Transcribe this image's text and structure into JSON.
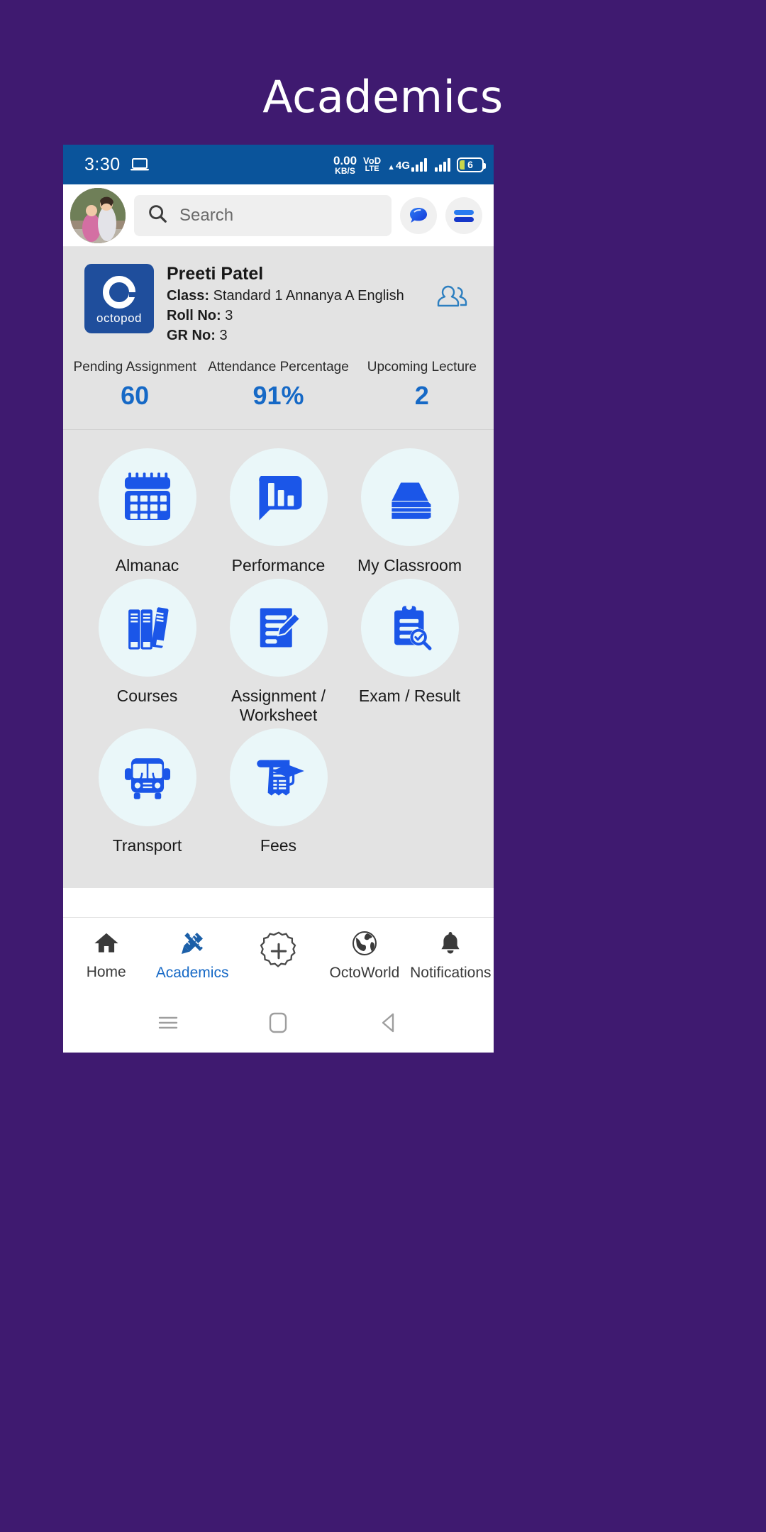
{
  "page": {
    "title": "Academics",
    "background_color": "#3F1A70"
  },
  "statusbar": {
    "time": "3:30",
    "laptop_icon": "laptop-icon",
    "data_rate_value": "0.00",
    "data_rate_unit": "KB/S",
    "volte_line1": "VoD",
    "volte_line2": "LTE",
    "network": "4G",
    "battery_level": "6"
  },
  "header": {
    "avatar": "user-avatar",
    "search_placeholder": "Search",
    "search_icon": "search-icon",
    "chat_icon": "chat-bubble-icon",
    "menu_icon": "hamburger-menu-icon"
  },
  "profile": {
    "logo_word": "octopod",
    "name": "Preeti Patel",
    "class_label": "Class:",
    "class_value": "Standard 1 Annanya A English",
    "roll_label": "Roll No:",
    "roll_value": "3",
    "gr_label": "GR No:",
    "gr_value": "3",
    "people_icon": "people-icon",
    "stats": [
      {
        "label": "Pending Assignment",
        "value": "60"
      },
      {
        "label": "Attendance Percentage",
        "value": "91%"
      },
      {
        "label": "Upcoming Lecture",
        "value": "2"
      }
    ],
    "accent_color": "#1669C6"
  },
  "grid": {
    "tiles": [
      {
        "label": "Almanac",
        "icon": "calendar-icon"
      },
      {
        "label": "Performance",
        "icon": "bar-chart-bubble-icon"
      },
      {
        "label": "My Classroom",
        "icon": "book-stack-icon"
      },
      {
        "label": "Courses",
        "icon": "books-icon"
      },
      {
        "label": "Assignment / Worksheet",
        "icon": "document-pencil-icon"
      },
      {
        "label": "Exam / Result",
        "icon": "clipboard-search-icon"
      },
      {
        "label": "Transport",
        "icon": "bus-icon"
      },
      {
        "label": "Fees",
        "icon": "receipt-graduation-cap-icon"
      }
    ]
  },
  "bottom_nav": {
    "items": [
      {
        "label": "Home",
        "icon": "home-icon",
        "active": false
      },
      {
        "label": "Academics",
        "icon": "ruler-pencil-icon",
        "active": true
      },
      {
        "label": "",
        "icon": "plus-badge-icon",
        "active": false
      },
      {
        "label": "OctoWorld",
        "icon": "globe-icon",
        "active": false
      },
      {
        "label": "Notifications",
        "icon": "bell-icon",
        "active": false
      }
    ]
  },
  "android_nav": {
    "recents_icon": "recents-icon",
    "home_icon": "home-square-icon",
    "back_icon": "back-triangle-icon"
  }
}
